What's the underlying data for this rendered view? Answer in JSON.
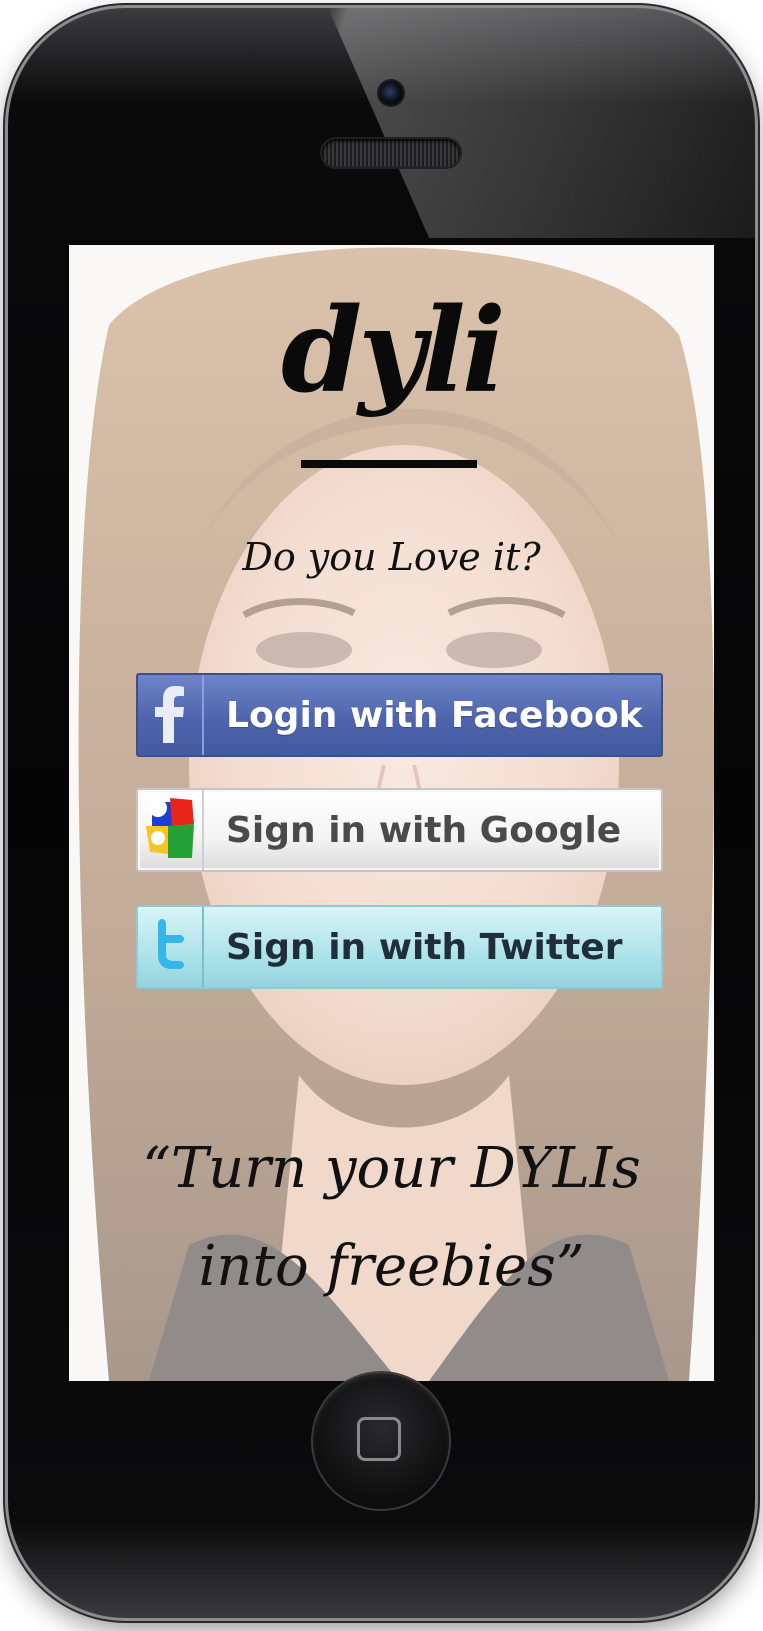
{
  "app": {
    "logo_text": "dyli",
    "tagline": "Do you Love it?"
  },
  "login": {
    "facebook": {
      "label": "Login with Facebook",
      "icon": "facebook-f-icon"
    },
    "google": {
      "label": "Sign in with Google",
      "icon": "google-icon"
    },
    "twitter": {
      "label": "Sign in with Twitter",
      "icon": "twitter-t-icon"
    }
  },
  "slogan": {
    "line1": "“Turn your DYLIs",
    "line2": "into freebies”"
  },
  "colors": {
    "facebook_blue": "#4e64ad",
    "twitter_teal": "#aee3ea",
    "google_grey": "#f4f4f4"
  }
}
